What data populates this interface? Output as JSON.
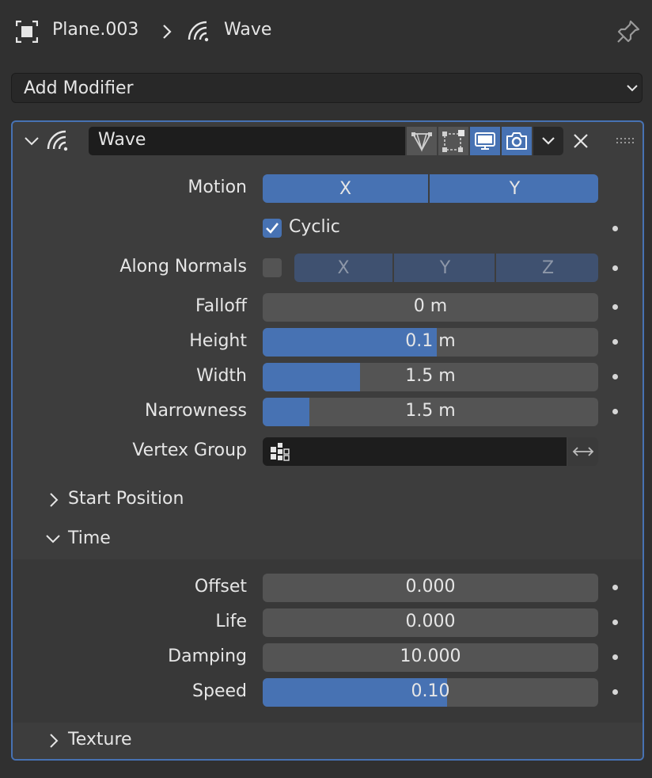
{
  "header": {
    "object_name": "Plane.003",
    "modifier_name": "Wave"
  },
  "add_modifier": {
    "label": "Add Modifier"
  },
  "panel": {
    "name": "Wave",
    "motion": {
      "label": "Motion",
      "x": "X",
      "y": "Y"
    },
    "cyclic": {
      "label": "Cyclic",
      "checked": true
    },
    "along_normals": {
      "label": "Along Normals",
      "x": "X",
      "y": "Y",
      "z": "Z",
      "checked": false
    },
    "falloff": {
      "label": "Falloff",
      "value": "0 m",
      "fill": 0
    },
    "height": {
      "label": "Height",
      "value": "0.1 m",
      "fill": 0.52
    },
    "width": {
      "label": "Width",
      "value": "1.5 m",
      "fill": 0.29
    },
    "narrowness": {
      "label": "Narrowness",
      "value": "1.5 m",
      "fill": 0.14
    },
    "vertex_group": {
      "label": "Vertex Group",
      "value": ""
    },
    "start_position": {
      "label": "Start Position",
      "expanded": false
    },
    "time": {
      "label": "Time",
      "expanded": true,
      "offset": {
        "label": "Offset",
        "value": "0.000",
        "fill": 0
      },
      "life": {
        "label": "Life",
        "value": "0.000",
        "fill": 0
      },
      "damping": {
        "label": "Damping",
        "value": "10.000",
        "fill": 0
      },
      "speed": {
        "label": "Speed",
        "value": "0.10",
        "fill": 0.55
      }
    },
    "texture": {
      "label": "Texture",
      "expanded": false
    }
  },
  "colors": {
    "accent": "#4772b3",
    "panel_border": "#4772b3",
    "background": "#303030"
  },
  "icons": [
    "object-data-icon",
    "wave-modifier-icon",
    "pin-icon",
    "edit-mode-icon",
    "cage-icon",
    "realtime-display-icon",
    "render-icon",
    "close-icon",
    "drag-handle-icon",
    "vertex-group-icon",
    "invert-icon"
  ]
}
